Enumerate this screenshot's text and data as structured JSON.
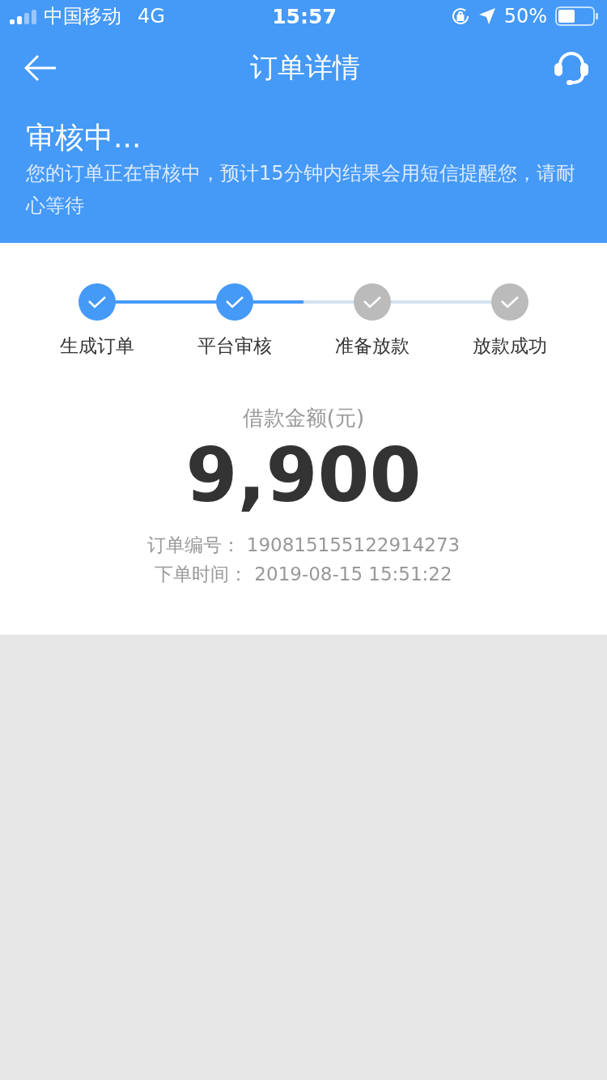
{
  "status_bar": {
    "carrier": "中国移动",
    "network": "4G",
    "time": "15:57",
    "battery_text": "50%"
  },
  "nav": {
    "title": "订单详情"
  },
  "banner": {
    "title": "审核中...",
    "message": "您的订单正在审核中，预计15分钟内结果会用短信提醒您，请耐心等待"
  },
  "steps": [
    {
      "label": "生成订单",
      "completed": true
    },
    {
      "label": "平台审核",
      "completed": true
    },
    {
      "label": "准备放款",
      "completed": false
    },
    {
      "label": "放款成功",
      "completed": false
    }
  ],
  "amount": {
    "label": "借款金额(元)",
    "value": "9,900"
  },
  "details": [
    {
      "label": "订单编号：",
      "value": "190815155122914273"
    },
    {
      "label": "下单时间：",
      "value": "2019-08-15 15:51:22"
    }
  ]
}
